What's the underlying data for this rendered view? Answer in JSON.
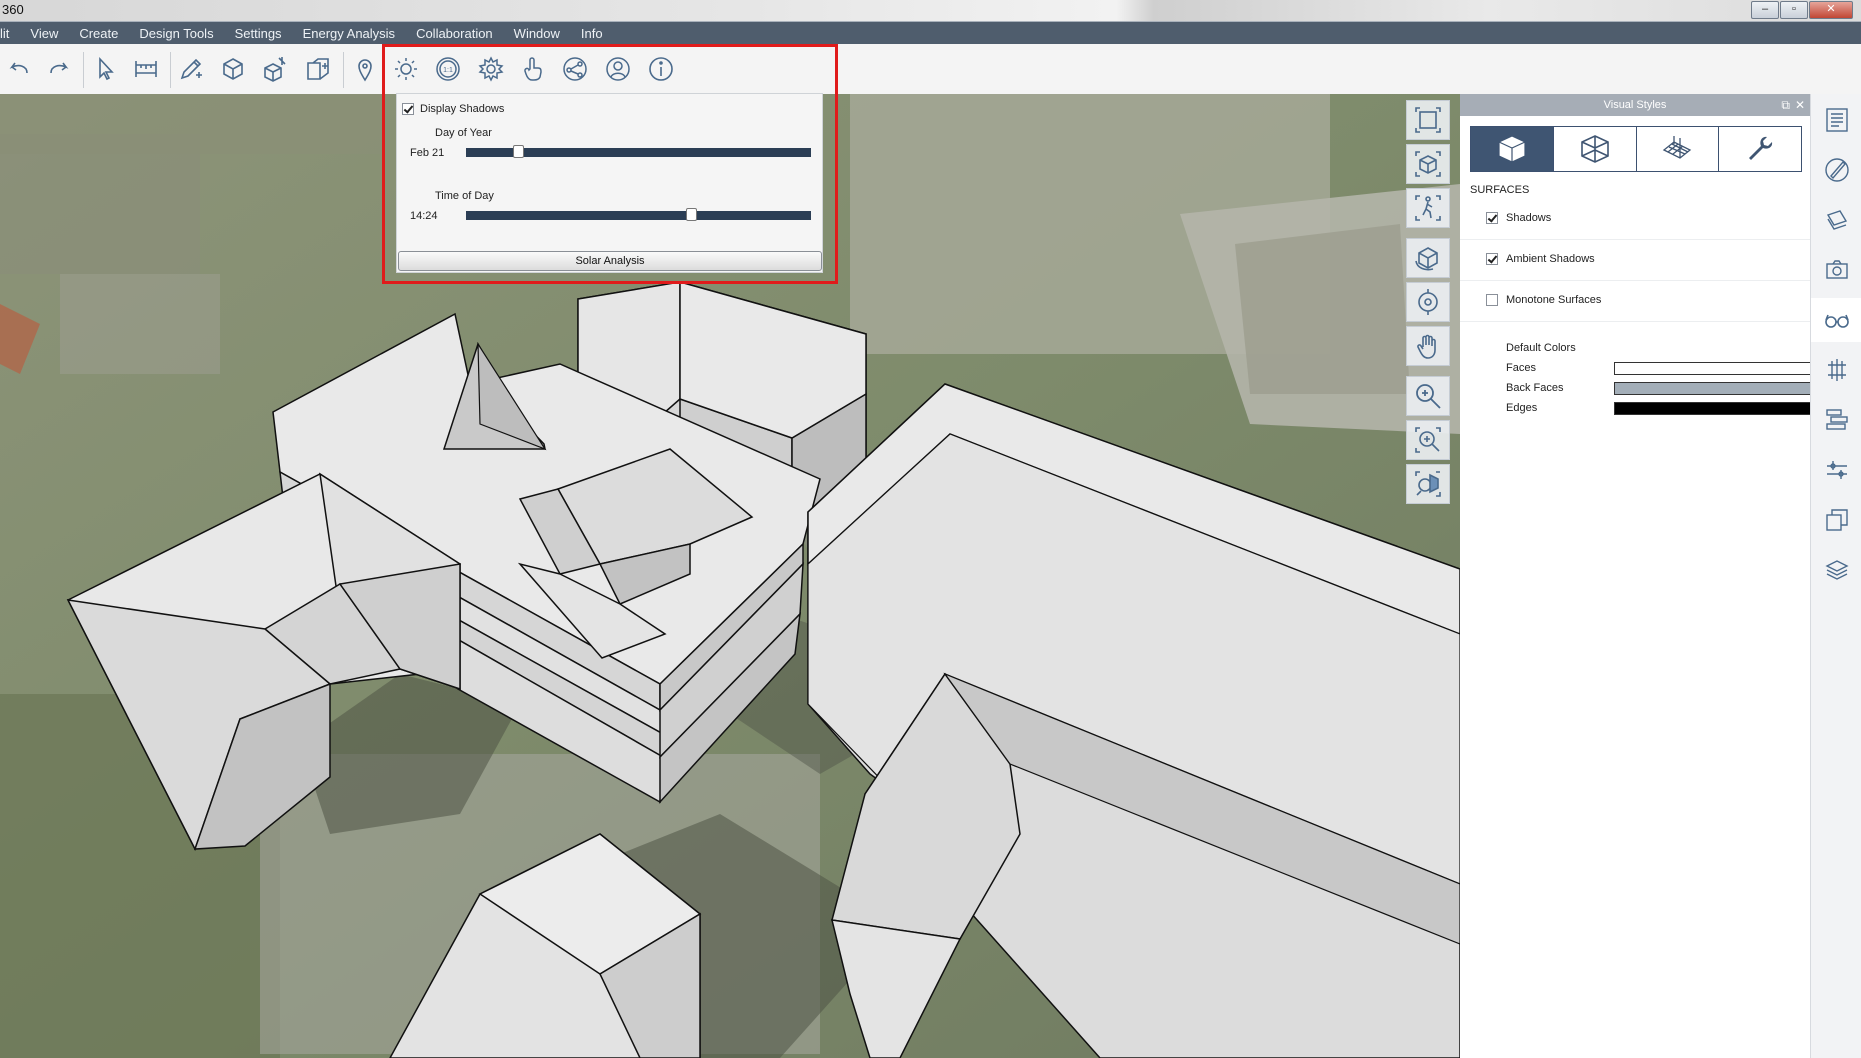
{
  "window": {
    "title": "360",
    "controls": [
      "minimize",
      "restore",
      "close"
    ]
  },
  "menu": [
    "lit",
    "View",
    "Create",
    "Design Tools",
    "Settings",
    "Energy Analysis",
    "Collaboration",
    "Window",
    "Info"
  ],
  "toolbar": {
    "tools": [
      "undo-icon",
      "redo-icon",
      "select-icon",
      "measure-icon",
      "draw-icon",
      "box-icon",
      "add-form-icon",
      "add-level-icon",
      "location-icon",
      "sun-icon",
      "scale-icon",
      "settings-icon",
      "touch-icon",
      "share-icon",
      "user-icon",
      "info-icon"
    ]
  },
  "sun_panel": {
    "display_shadows_label": "Display Shadows",
    "display_shadows_checked": true,
    "day_of_year_label": "Day of Year",
    "day_value": "Feb 21",
    "day_fraction": 0.14,
    "time_of_day_label": "Time of Day",
    "time_value": "14:24",
    "time_fraction": 0.66,
    "solar_button": "Solar Analysis"
  },
  "nav_tools": [
    "fit-view-icon",
    "iso-view-icon",
    "walk-icon",
    "orbit-icon",
    "look-around-icon",
    "pan-icon",
    "zoom-icon",
    "zoom-window-icon",
    "zoom-selection-icon"
  ],
  "visual_styles": {
    "title": "Visual Styles",
    "tabs": [
      "solid-style-icon",
      "wireframe-style-icon",
      "grid-style-icon",
      "wrench-style-icon"
    ],
    "section": "SURFACES",
    "options": [
      {
        "label": "Shadows",
        "checked": true
      },
      {
        "label": "Ambient Shadows",
        "checked": true
      },
      {
        "label": "Monotone Surfaces",
        "checked": false
      }
    ],
    "default_colors_label": "Default Colors",
    "colors": [
      {
        "label": "Faces",
        "color": "#ffffff"
      },
      {
        "label": "Back Faces",
        "color": "#a3aeb8"
      },
      {
        "label": "Edges",
        "color": "#000000"
      }
    ]
  },
  "right_strip": [
    "properties-icon",
    "paint-icon",
    "layers-icon",
    "camera-icon",
    "glasses-icon",
    "structure-icon",
    "stack-icon",
    "align-icon",
    "copy-icon",
    "levels-icon"
  ]
}
